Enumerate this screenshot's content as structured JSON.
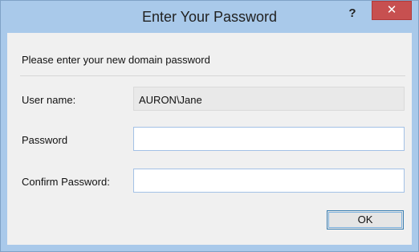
{
  "window": {
    "title": "Enter Your Password",
    "help_icon": "?",
    "close_icon": "✕"
  },
  "dialog": {
    "instruction": "Please enter your new domain password",
    "username_label": "User name:",
    "username_value": "AURON\\Jane",
    "password_label": "Password",
    "password_value": "",
    "confirm_label": "Confirm Password:",
    "confirm_value": "",
    "ok_label": "OK"
  },
  "colors": {
    "titlebar": "#a9c9ea",
    "close_button": "#c75050",
    "client": "#f0f0f0",
    "focus_border": "#3c7fb1"
  }
}
